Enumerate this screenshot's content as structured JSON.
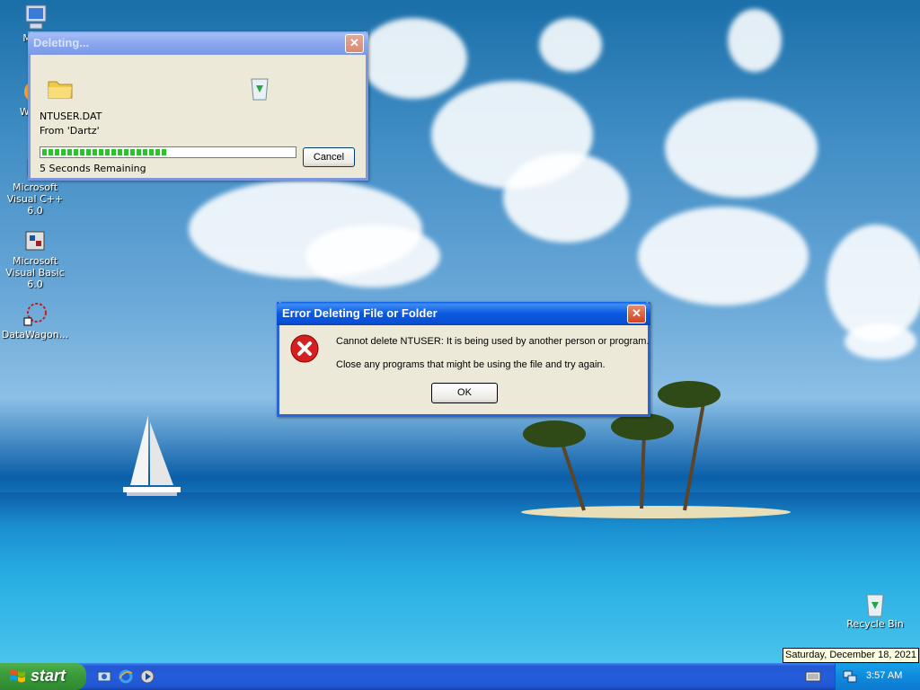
{
  "desktop": {
    "icons": [
      {
        "label": "My C"
      },
      {
        "label": "Windo\nP"
      },
      {
        "label": "Microsoft Visual C++ 6.0"
      },
      {
        "label": "Microsoft Visual Basic 6.0"
      },
      {
        "label": "DataWagon..."
      },
      {
        "label": "Recycle Bin"
      }
    ]
  },
  "deleting_dialog": {
    "title": "Deleting...",
    "file_name": "NTUSER.DAT",
    "from_text": "From 'Dartz'",
    "progress_fraction": 0.5,
    "remaining_text": "5 Seconds Remaining",
    "cancel_label": "Cancel",
    "close_glyph": "✕"
  },
  "error_dialog": {
    "title": "Error Deleting File or Folder",
    "message_line1": "Cannot delete NTUSER: It is being used by another person or program.",
    "message_line2": "Close any programs that might be using the file and try again.",
    "ok_label": "OK",
    "close_glyph": "✕",
    "icon": "error-icon"
  },
  "taskbar": {
    "start_label": "start",
    "quick_launch": [
      "show-desktop-icon",
      "internet-explorer-icon",
      "media-player-icon"
    ],
    "tray_icons": [
      "network-icon"
    ],
    "clock": "3:57 AM",
    "keyboard_icon": "keyboard-icon",
    "date_tooltip": "Saturday, December 18, 2021"
  },
  "colors": {
    "title_active": "#0a5ae0",
    "title_inactive": "#8aa7ef",
    "dialog_bg": "#ece9d8",
    "taskbar": "#245ddb",
    "start": "#3c9c3c"
  }
}
